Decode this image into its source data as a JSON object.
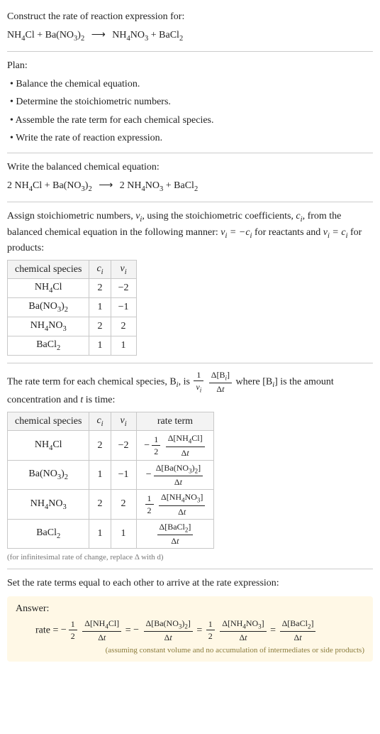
{
  "intro": {
    "title": "Construct the rate of reaction expression for:",
    "reactants": "NH4Cl + Ba(NO3)2",
    "arrow": "⟶",
    "products": "NH4NO3 + BaCl2"
  },
  "plan": {
    "heading": "Plan:",
    "b1": "• Balance the chemical equation.",
    "b2": "• Determine the stoichiometric numbers.",
    "b3": "• Assemble the rate term for each chemical species.",
    "b4": "• Write the rate of reaction expression."
  },
  "balanced": {
    "heading": "Write the balanced chemical equation:",
    "reactants": "2 NH4Cl + Ba(NO3)2",
    "arrow": "⟶",
    "products": "2 NH4NO3 + BaCl2"
  },
  "assign": {
    "text1": "Assign stoichiometric numbers, ",
    "nu_i": "νᵢ",
    "text2": ", using the stoichiometric coefficients, ",
    "c_i": "cᵢ",
    "text3": ", from the balanced chemical equation in the following manner: ",
    "rule1": "νᵢ = −cᵢ",
    "text4": " for reactants and ",
    "rule2": "νᵢ = cᵢ",
    "text5": " for products:"
  },
  "table1": {
    "h0": "chemical species",
    "h1": "cᵢ",
    "h2": "νᵢ",
    "r0": {
      "sp": "NH4Cl",
      "c": "2",
      "v": "−2"
    },
    "r1": {
      "sp": "Ba(NO3)2",
      "c": "1",
      "v": "−1"
    },
    "r2": {
      "sp": "NH4NO3",
      "c": "2",
      "v": "2"
    },
    "r3": {
      "sp": "BaCl2",
      "c": "1",
      "v": "1"
    }
  },
  "rate_term": {
    "text1": "The rate term for each chemical species, B",
    "sub_i": "i",
    "text2": ", is ",
    "one": "1",
    "nu_i": "νᵢ",
    "deltaB": "Δ[Bᵢ]",
    "deltat": "Δt",
    "text3": " where [B",
    "text4": "] is the amount concentration and ",
    "t": "t",
    "text5": " is time:"
  },
  "table2": {
    "h0": "chemical species",
    "h1": "cᵢ",
    "h2": "νᵢ",
    "h3": "rate term",
    "r0": {
      "sp": "NH4Cl",
      "c": "2",
      "v": "−2",
      "coef_neg": "−",
      "coef_num": "1",
      "coef_den": "2",
      "num": "Δ[NH4Cl]",
      "den": "Δt"
    },
    "r1": {
      "sp": "Ba(NO3)2",
      "c": "1",
      "v": "−1",
      "coef_neg": "−",
      "num": "Δ[Ba(NO3)2]",
      "den": "Δt"
    },
    "r2": {
      "sp": "NH4NO3",
      "c": "2",
      "v": "2",
      "coef_num": "1",
      "coef_den": "2",
      "num": "Δ[NH4NO3]",
      "den": "Δt"
    },
    "r3": {
      "sp": "BaCl2",
      "c": "1",
      "v": "1",
      "num": "Δ[BaCl2]",
      "den": "Δt"
    }
  },
  "footnote": "(for infinitesimal rate of change, replace Δ with d)",
  "set_equal": "Set the rate terms equal to each other to arrive at the rate expression:",
  "answer": {
    "label": "Answer:",
    "rate": "rate",
    "eq": "=",
    "neg": "−",
    "half_num": "1",
    "half_den": "2",
    "t1_num": "Δ[NH4Cl]",
    "t1_den": "Δt",
    "t2_num": "Δ[Ba(NO3)2]",
    "t2_den": "Δt",
    "t3_num": "Δ[NH4NO3]",
    "t3_den": "Δt",
    "t4_num": "Δ[BaCl2]",
    "t4_den": "Δt",
    "note": "(assuming constant volume and no accumulation of intermediates or side products)"
  },
  "chart_data": {
    "type": "table",
    "title": "Stoichiometric numbers and rate terms",
    "species": [
      "NH4Cl",
      "Ba(NO3)2",
      "NH4NO3",
      "BaCl2"
    ],
    "c_i": [
      2,
      1,
      2,
      1
    ],
    "nu_i": [
      -2,
      -1,
      2,
      1
    ],
    "rate_terms": [
      "-(1/2) Δ[NH4Cl]/Δt",
      "- Δ[Ba(NO3)2]/Δt",
      "(1/2) Δ[NH4NO3]/Δt",
      "Δ[BaCl2]/Δt"
    ],
    "rate_expression": "rate = -(1/2) Δ[NH4Cl]/Δt = - Δ[Ba(NO3)2]/Δt = (1/2) Δ[NH4NO3]/Δt = Δ[BaCl2]/Δt"
  }
}
